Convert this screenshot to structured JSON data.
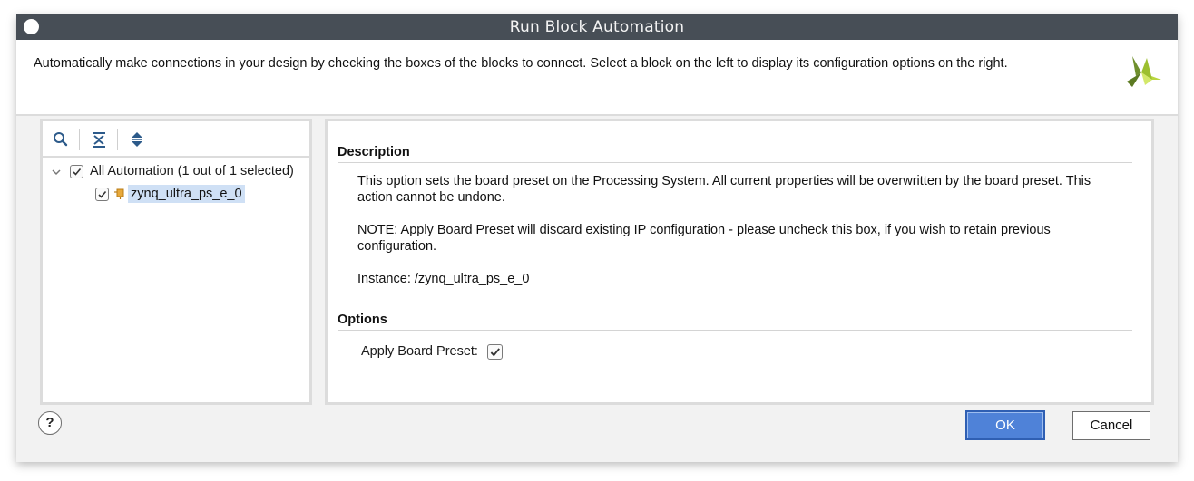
{
  "window": {
    "title": "Run Block Automation"
  },
  "header": {
    "instructions": "Automatically make connections in your design by checking the boxes of the blocks to connect. Select a block on the left to display its configuration options on the right.",
    "logo_icon": "xilinx-logo-icon"
  },
  "tree_toolbar": {
    "icons": [
      "search-icon",
      "collapse-all-icon",
      "expand-all-icon"
    ]
  },
  "tree": {
    "root_label": "All Automation (1 out of 1 selected)",
    "root_checked": true,
    "root_expanded": true,
    "child_label": "zynq_ultra_ps_e_0",
    "child_checked": true,
    "child_icon": "ip-block-icon"
  },
  "details": {
    "description_title": "Description",
    "description_p1": "This option sets the board preset on the Processing System. All current properties will be overwritten by the board preset. This action cannot be undone.",
    "description_p2": "NOTE: Apply Board Preset will discard existing IP configuration - please uncheck this box, if you wish to retain previous configuration.",
    "instance_text": "Instance: /zynq_ultra_ps_e_0",
    "options_title": "Options",
    "apply_board_preset_label": "Apply Board Preset:",
    "apply_board_preset_checked": true
  },
  "footer": {
    "help_label": "?",
    "ok_label": "OK",
    "cancel_label": "Cancel"
  },
  "colors": {
    "titlebar_bg": "#474e56",
    "selection_bg": "#cfe0f5",
    "primary_button": "#4f82d8",
    "logo_dark": "#6a8a2a",
    "logo_light": "#b8d43c"
  }
}
